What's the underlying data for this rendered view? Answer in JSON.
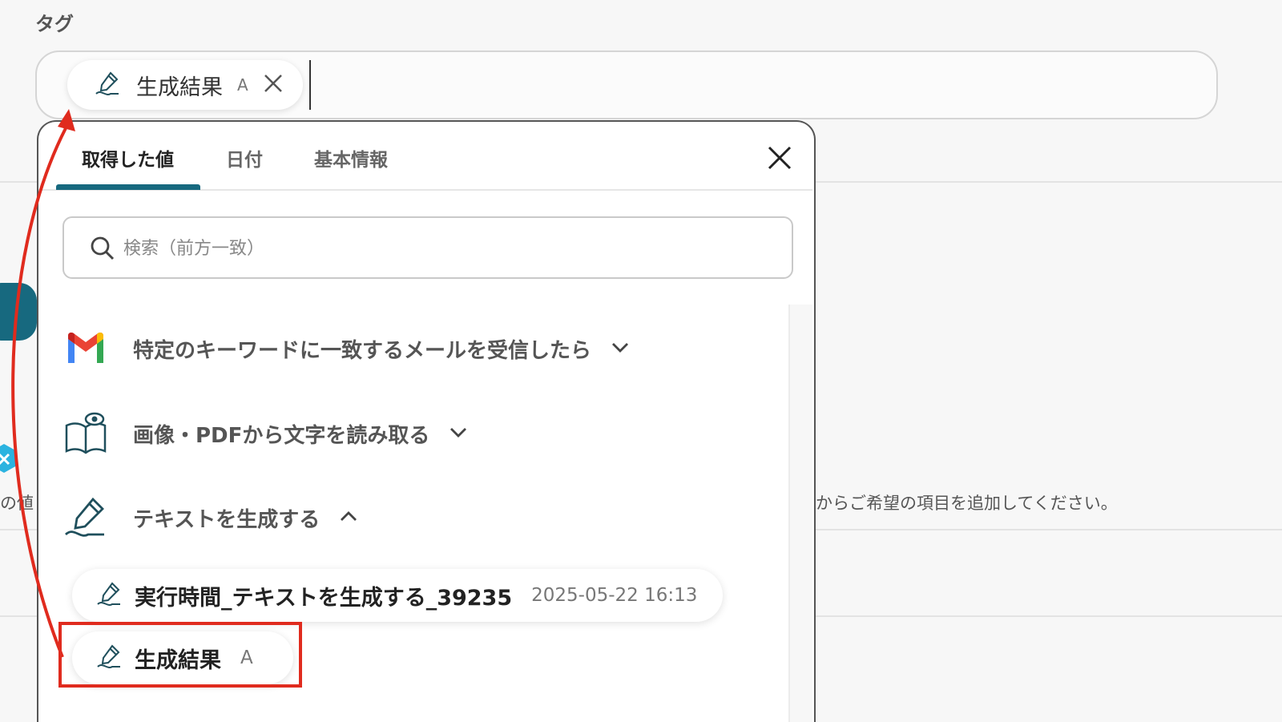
{
  "tag_field": {
    "label": "タグ",
    "chip": {
      "label": "生成結果",
      "type": "A"
    }
  },
  "background": {
    "right_text": "からご希望の項目を追加してください。",
    "left_text": "の値"
  },
  "popup": {
    "tabs": [
      {
        "label": "取得した値",
        "active": true
      },
      {
        "label": "日付",
        "active": false
      },
      {
        "label": "基本情報",
        "active": false
      }
    ],
    "search_placeholder": "検索（前方一致）",
    "groups": [
      {
        "title": "特定のキーワードに一致するメールを受信したら",
        "icon": "gmail-icon",
        "expanded": false
      },
      {
        "title": "画像・PDFから文字を読み取る",
        "icon": "ocr-book-icon",
        "expanded": false
      },
      {
        "title": "テキストを生成する",
        "icon": "ai-pen-icon",
        "expanded": true
      }
    ],
    "items": [
      {
        "label": "実行時間_テキストを生成する_39235",
        "meta": "2025-05-22 16:13"
      },
      {
        "label": "生成結果",
        "meta": "A"
      }
    ]
  },
  "colors": {
    "accent": "#17697f",
    "annotation": "#e02b1e"
  }
}
